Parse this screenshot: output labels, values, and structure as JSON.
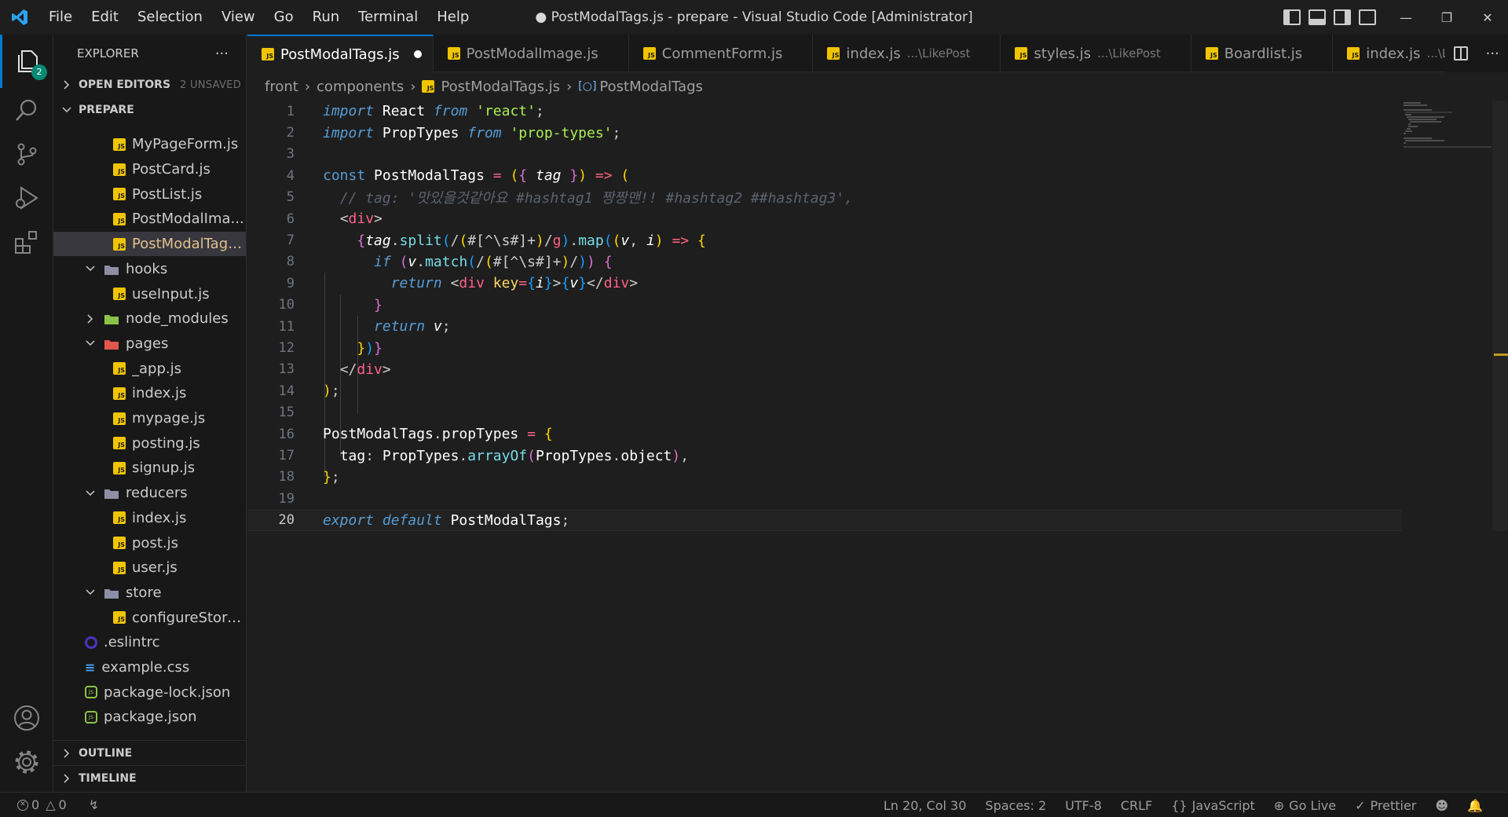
{
  "titlebar": {
    "menu": [
      "File",
      "Edit",
      "Selection",
      "View",
      "Go",
      "Run",
      "Terminal",
      "Help"
    ],
    "window_title": "● PostModalTags.js - prepare - Visual Studio Code [Administrator]"
  },
  "activity": {
    "explorer_badge": "2"
  },
  "sidebar": {
    "title": "EXPLORER",
    "more": "···",
    "open_editors": "OPEN EDITORS",
    "unsaved": "2 UNSAVED",
    "project": "PREPARE",
    "tree": [
      {
        "name": "MyPageForm.js",
        "type": "js",
        "depth": 2
      },
      {
        "name": "PostCard.js",
        "type": "js",
        "depth": 2
      },
      {
        "name": "PostList.js",
        "type": "js",
        "depth": 2
      },
      {
        "name": "PostModalIma...",
        "type": "js",
        "depth": 2
      },
      {
        "name": "PostModalTags...",
        "type": "js",
        "depth": 2,
        "selected": true
      },
      {
        "name": "hooks",
        "type": "folder-open",
        "depth": 1
      },
      {
        "name": "useInput.js",
        "type": "js",
        "depth": 2
      },
      {
        "name": "node_modules",
        "type": "folder-node",
        "depth": 1
      },
      {
        "name": "pages",
        "type": "folder-pages",
        "depth": 1
      },
      {
        "name": "_app.js",
        "type": "js",
        "depth": 2
      },
      {
        "name": "index.js",
        "type": "js",
        "depth": 2
      },
      {
        "name": "mypage.js",
        "type": "js",
        "depth": 2
      },
      {
        "name": "posting.js",
        "type": "js",
        "depth": 2
      },
      {
        "name": "signup.js",
        "type": "js",
        "depth": 2
      },
      {
        "name": "reducers",
        "type": "folder-open",
        "depth": 1
      },
      {
        "name": "index.js",
        "type": "js",
        "depth": 2
      },
      {
        "name": "post.js",
        "type": "js",
        "depth": 2
      },
      {
        "name": "user.js",
        "type": "js",
        "depth": 2
      },
      {
        "name": "store",
        "type": "folder-open",
        "depth": 1
      },
      {
        "name": "configureStore.js",
        "type": "js",
        "depth": 2
      },
      {
        "name": ".eslintrc",
        "type": "eslint",
        "depth": 1
      },
      {
        "name": "example.css",
        "type": "css",
        "depth": 1
      },
      {
        "name": "package-lock.json",
        "type": "json",
        "depth": 1
      },
      {
        "name": "package.json",
        "type": "json",
        "depth": 1
      }
    ],
    "outline": "OUTLINE",
    "timeline": "TIMELINE"
  },
  "tabs": [
    {
      "label": "PostModalTags.js",
      "desc": "",
      "active": true,
      "dirty": true
    },
    {
      "label": "PostModalImage.js",
      "desc": ""
    },
    {
      "label": "CommentForm.js",
      "desc": ""
    },
    {
      "label": "index.js",
      "desc": "...\\LikePost"
    },
    {
      "label": "styles.js",
      "desc": "...\\LikePost"
    },
    {
      "label": "Boardlist.js",
      "desc": ""
    },
    {
      "label": "index.js",
      "desc": "...\\Like"
    }
  ],
  "breadcrumb": [
    "front",
    "components",
    "PostModalTags.js",
    "PostModalTags"
  ],
  "status": {
    "errors": "0",
    "warnings": "0",
    "position": "Ln 20, Col 30",
    "spaces": "Spaces: 2",
    "encoding": "UTF-8",
    "eol": "CRLF",
    "language": "JavaScript",
    "golive": "Go Live",
    "prettier": "Prettier"
  },
  "colors": {
    "accent": "#0078d4",
    "js_icon": "#f0c400"
  }
}
